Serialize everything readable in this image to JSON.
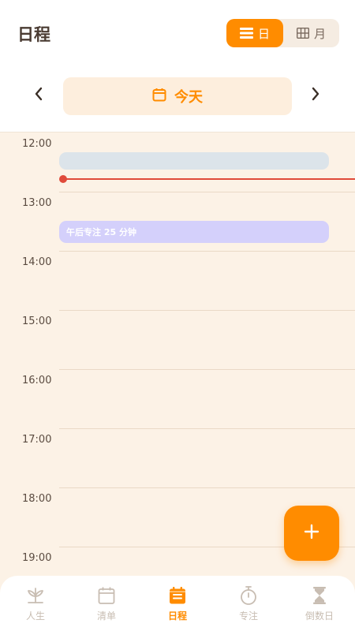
{
  "header": {
    "title": "日程",
    "view_toggle": {
      "day_label": "日",
      "month_label": "月",
      "selected": "day"
    }
  },
  "date_nav": {
    "today_label": "今天",
    "prev_icon": "chevron-left-icon",
    "next_icon": "chevron-right-icon"
  },
  "timeline": {
    "hours": [
      "12:00",
      "13:00",
      "14:00",
      "15:00",
      "16:00",
      "17:00",
      "18:00",
      "19:00"
    ],
    "current_time_indicator": true,
    "events": [
      {
        "title": "",
        "color": "#dce4ea"
      },
      {
        "title": "午后专注 25 分钟",
        "color": "#d4d0fb"
      }
    ]
  },
  "fab": {
    "icon": "plus-icon"
  },
  "bottom_nav": {
    "items": [
      {
        "label": "人生",
        "icon": "leaf-icon",
        "active": false
      },
      {
        "label": "清单",
        "icon": "calendar-icon",
        "active": false
      },
      {
        "label": "日程",
        "icon": "schedule-icon",
        "active": true
      },
      {
        "label": "专注",
        "icon": "stopwatch-icon",
        "active": false
      },
      {
        "label": "倒数日",
        "icon": "hourglass-icon",
        "active": false
      }
    ]
  },
  "colors": {
    "accent": "#ff8c00",
    "background": "#fcf2e6",
    "now_line": "#e04a3a",
    "inactive": "#c8bdb2"
  }
}
